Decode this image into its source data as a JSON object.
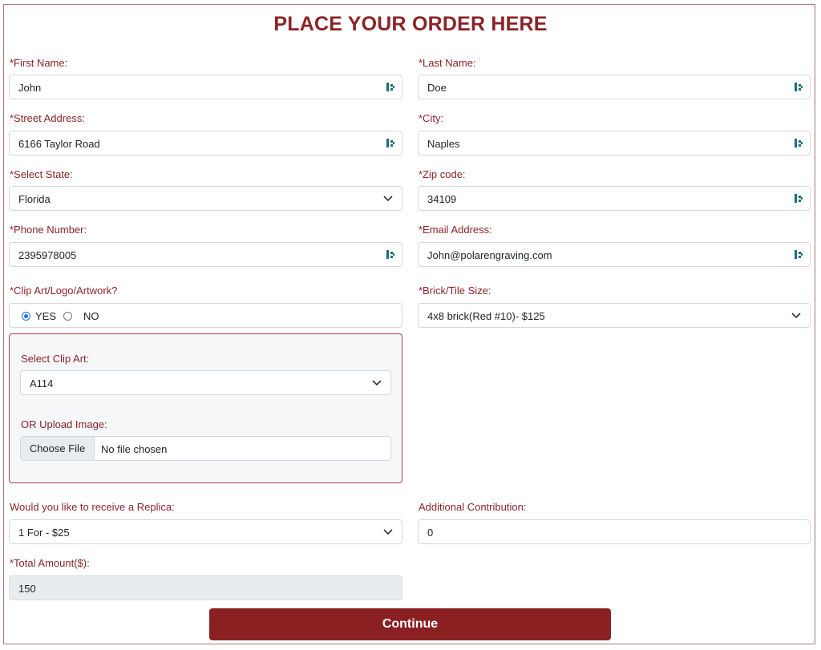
{
  "page": {
    "title": "PLACE YOUR ORDER HERE"
  },
  "fields": {
    "first_name": {
      "label": "*First Name:",
      "value": "John"
    },
    "last_name": {
      "label": "*Last Name:",
      "value": "Doe"
    },
    "street": {
      "label": "*Street Address:",
      "value": "6166 Taylor Road"
    },
    "city": {
      "label": "*City:",
      "value": "Naples"
    },
    "state": {
      "label": "*Select State:",
      "value": "Florida"
    },
    "zip": {
      "label": "*Zip code:",
      "value": "34109"
    },
    "phone": {
      "label": "*Phone Number:",
      "value": "2395978005"
    },
    "email": {
      "label": "*Email Address:",
      "value": "John@polarengraving.com"
    },
    "clip_art_q": {
      "label": "*Clip Art/Logo/Artwork?",
      "yes": "YES",
      "no": "NO",
      "selected": "YES"
    },
    "brick_size": {
      "label": "*Brick/Tile Size:",
      "value": "4x8 brick(Red #10)- $125"
    },
    "clip_select": {
      "label": "Select Clip Art:",
      "value": "A114"
    },
    "upload": {
      "label": "OR Upload Image:",
      "button": "Choose File",
      "status": "No file chosen"
    },
    "replica": {
      "label": "Would you like to receive a Replica:",
      "value": "1 For - $25"
    },
    "contribution": {
      "label": "Additional Contribution:",
      "value": "0"
    },
    "total": {
      "label": "*Total Amount($):",
      "value": "150"
    }
  },
  "actions": {
    "continue": "Continue"
  },
  "icons": {
    "autofill": "password-manager-key-icon",
    "dropdown": "chevron-down-icon"
  },
  "colors": {
    "brand": "#8b2327",
    "button": "#8b2022",
    "radio_accent": "#1a73e8"
  }
}
